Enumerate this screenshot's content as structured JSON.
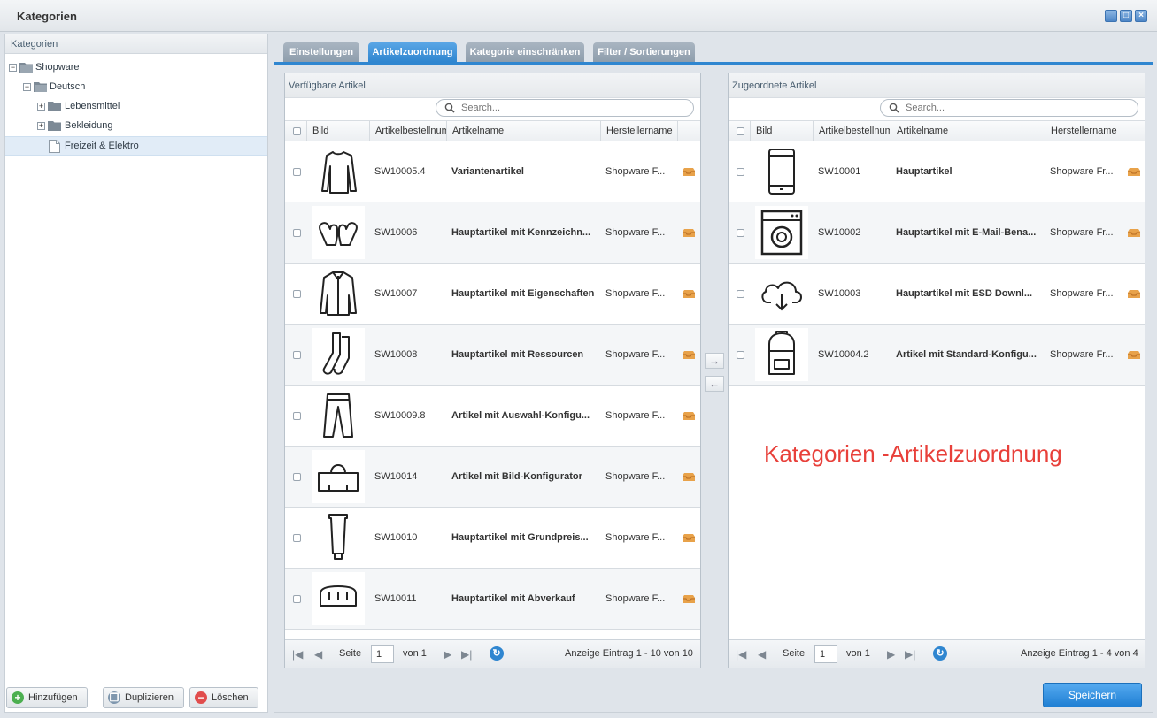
{
  "window": {
    "title": "Kategorien"
  },
  "tree": {
    "header": "Kategorien",
    "nodes": [
      {
        "label": "Shopware",
        "icon": "folder-open-icon"
      },
      {
        "label": "Deutsch",
        "icon": "folder-open-icon"
      },
      {
        "label": "Lebensmittel",
        "icon": "folder-icon"
      },
      {
        "label": "Bekleidung",
        "icon": "folder-icon"
      },
      {
        "label": "Freizeit & Elektro",
        "icon": "document-icon"
      }
    ]
  },
  "footer": {
    "add": "Hinzufügen",
    "duplicate": "Duplizieren",
    "delete": "Löschen"
  },
  "tabs": [
    "Einstellungen",
    "Artikelzuordnung",
    "Kategorie einschränken",
    "Filter / Sortierungen"
  ],
  "active_tab": "Artikelzuordnung",
  "available": {
    "title": "Verfügbare Artikel",
    "search_placeholder": "Search...",
    "columns": {
      "image": "Bild",
      "number": "Artikelbestellnummer",
      "name": "Artikelname",
      "manufacturer": "Herstellername"
    },
    "rows": [
      {
        "icon": "sweater-icon",
        "number": "SW10005.4",
        "name": "Variantenartikel",
        "manufacturer": "Shopware F..."
      },
      {
        "icon": "mittens-icon",
        "number": "SW10006",
        "name": "Hauptartikel mit Kennzeichn...",
        "manufacturer": "Shopware F..."
      },
      {
        "icon": "jacket-icon",
        "number": "SW10007",
        "name": "Hauptartikel mit Eigenschaften",
        "manufacturer": "Shopware F..."
      },
      {
        "icon": "socks-icon",
        "number": "SW10008",
        "name": "Hauptartikel mit Ressourcen",
        "manufacturer": "Shopware F..."
      },
      {
        "icon": "trousers-icon",
        "number": "SW10009.8",
        "name": "Artikel mit Auswahl-Konfigu...",
        "manufacturer": "Shopware F..."
      },
      {
        "icon": "bag-icon",
        "number": "SW10014",
        "name": "Artikel mit Bild-Konfigurator",
        "manufacturer": "Shopware F..."
      },
      {
        "icon": "tube-icon",
        "number": "SW10010",
        "name": "Hauptartikel mit Grundpreis...",
        "manufacturer": "Shopware F..."
      },
      {
        "icon": "bread-icon",
        "number": "SW10011",
        "name": "Hauptartikel mit Abverkauf",
        "manufacturer": "Shopware F..."
      }
    ],
    "pager": {
      "page_label": "Seite",
      "page": "1",
      "of": "von 1",
      "info": "Anzeige Eintrag 1 - 10 von 10"
    }
  },
  "assigned": {
    "title": "Zugeordnete Artikel",
    "search_placeholder": "Search...",
    "columns": {
      "image": "Bild",
      "number": "Artikelbestellnummer",
      "name": "Artikelname",
      "manufacturer": "Herstellername"
    },
    "rows": [
      {
        "icon": "smartphone-icon",
        "number": "SW10001",
        "name": "Hauptartikel",
        "manufacturer": "Shopware Fr..."
      },
      {
        "icon": "washing-machine-icon",
        "number": "SW10002",
        "name": "Hauptartikel mit E-Mail-Bena...",
        "manufacturer": "Shopware Fr..."
      },
      {
        "icon": "cloud-download-icon",
        "number": "SW10003",
        "name": "Hauptartikel mit ESD Downl...",
        "manufacturer": "Shopware Fr..."
      },
      {
        "icon": "backpack-icon",
        "number": "SW10004.2",
        "name": "Artikel mit Standard-Konfigu...",
        "manufacturer": "Shopware Fr..."
      }
    ],
    "pager": {
      "page_label": "Seite",
      "page": "1",
      "of": "von 1",
      "info": "Anzeige Eintrag 1 - 4 von 4"
    }
  },
  "annotation": "Kategorien -Artikelzuordnung",
  "save_label": "Speichern",
  "colors": {
    "accent": "#2f86d0",
    "annotation": "#e8403a",
    "tab_inactive": "#98a6b4"
  }
}
